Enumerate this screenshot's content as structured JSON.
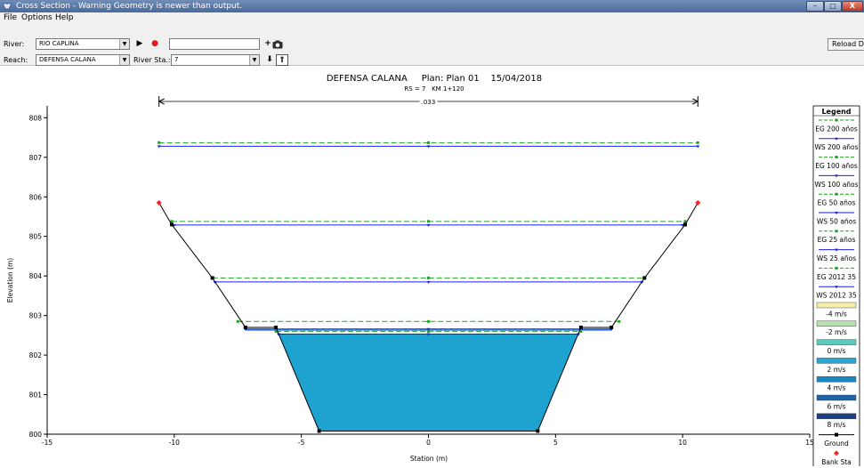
{
  "window": {
    "title": "Cross Section - Warning Geometry is newer than output.",
    "min_label": "–",
    "max_label": "▢",
    "close_label": "X"
  },
  "menu": {
    "file": "File",
    "options": "Options",
    "help": "Help"
  },
  "toolbar": {
    "river_label": "River:",
    "river_value": "RIO CAPLINA",
    "reach_label": "Reach:",
    "reach_value": "DEFENSA CALANA",
    "river_sta_label": "River Sta.:",
    "river_sta_value": "7",
    "reload_label": "Reload Data"
  },
  "chart_data": {
    "type": "line",
    "title": "DEFENSA CALANA     Plan: Plan 01    15/04/2018",
    "subtitle": "RS = 7   KM 1+120",
    "xlabel": "Station (m)",
    "ylabel": "Elevation (m)",
    "xlim": [
      -15,
      15
    ],
    "ylim": [
      800,
      808.3
    ],
    "xticks": [
      -15,
      -10,
      -5,
      0,
      5,
      10,
      15
    ],
    "yticks": [
      800,
      801,
      802,
      803,
      804,
      805,
      806,
      807,
      808
    ],
    "manning_label": ".033",
    "manning_extent": [
      -10.6,
      10.6
    ],
    "ground": {
      "x": [
        -10.6,
        -10.1,
        -8.5,
        -7.2,
        -6.0,
        -4.3,
        4.3,
        6.0,
        7.2,
        8.5,
        10.1,
        10.6
      ],
      "y": [
        805.85,
        805.3,
        803.95,
        802.7,
        802.7,
        800.08,
        800.08,
        802.7,
        802.7,
        803.95,
        805.3,
        805.85
      ]
    },
    "bank_stations": [
      [
        -10.6,
        805.85
      ],
      [
        10.6,
        805.85
      ]
    ],
    "fill_polygon": {
      "x": [
        -5.9,
        -4.3,
        4.3,
        5.9
      ],
      "y": [
        802.53,
        800.08,
        800.08,
        802.53
      ]
    },
    "series": [
      {
        "name": "EG 200 años",
        "type": "EG",
        "y": 807.37,
        "x_range": [
          -10.6,
          10.6
        ]
      },
      {
        "name": "WS 200 años",
        "type": "WS",
        "y": 807.28,
        "x_range": [
          -10.6,
          10.6
        ]
      },
      {
        "name": "EG 100 años",
        "type": "EG",
        "y": 805.38,
        "x_range": [
          -10.1,
          10.1
        ]
      },
      {
        "name": "WS 100 años",
        "type": "WS",
        "y": 805.29,
        "x_range": [
          -10.0,
          10.0
        ]
      },
      {
        "name": "EG 50 años",
        "type": "EG",
        "y": 803.95,
        "x_range": [
          -8.5,
          8.5
        ]
      },
      {
        "name": "WS 50 años",
        "type": "WS",
        "y": 803.85,
        "x_range": [
          -8.4,
          8.4
        ]
      },
      {
        "name": "EG 25 años",
        "type": "EG",
        "y": 802.85,
        "x_range": [
          -7.5,
          7.5
        ]
      },
      {
        "name": "WS 25 años",
        "type": "WS",
        "y": 802.66,
        "x_range": [
          -7.2,
          7.2
        ]
      },
      {
        "name": "EG 2012 35",
        "type": "EG",
        "y": 802.6,
        "x_range": [
          -6.0,
          6.0
        ]
      },
      {
        "name": "WS 2012 35",
        "type": "WS",
        "y": 802.53,
        "x_range": [
          -5.9,
          5.9
        ]
      }
    ],
    "velocity_legend": [
      {
        "name": "-4 m/s",
        "color": "#f5eea8"
      },
      {
        "name": "-2 m/s",
        "color": "#b8e2b0"
      },
      {
        "name": "0 m/s",
        "color": "#5ec8c0"
      },
      {
        "name": "2 m/s",
        "color": "#2aa6d2"
      },
      {
        "name": "4 m/s",
        "color": "#1f86c2"
      },
      {
        "name": "6 m/s",
        "color": "#1e62a8"
      },
      {
        "name": "8 m/s",
        "color": "#1b3f88"
      }
    ],
    "legend": {
      "title": "Legend",
      "position": "right",
      "ground_label": "Ground",
      "bank_label": "Bank Sta"
    },
    "colors": {
      "eg": "#1aa61a",
      "ws": "#1f1fe6",
      "ground": "#000000",
      "bank": "#ff2020",
      "water_fill": "#1ea3d0",
      "thin_water": "#3a8fd8"
    }
  }
}
